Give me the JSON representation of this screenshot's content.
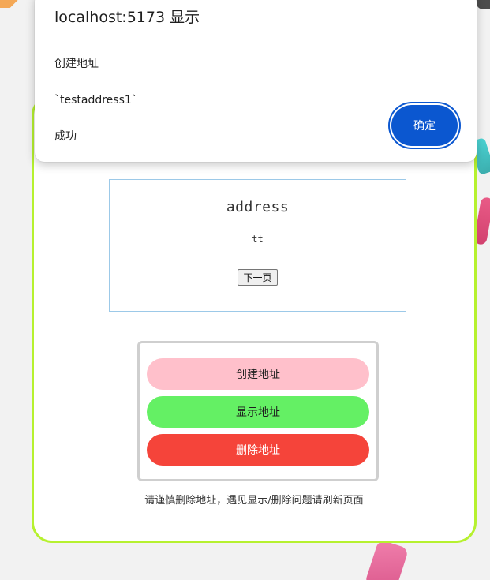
{
  "alert": {
    "title": "localhost:5173 显示",
    "message_lines": [
      "创建地址",
      "`testaddress1`",
      "成功"
    ],
    "ok_label": "确定"
  },
  "address_panel": {
    "title": "address",
    "value": "tt",
    "next_label": "下一页"
  },
  "actions": {
    "create_label": "创建地址",
    "show_label": "显示地址",
    "delete_label": "删除地址"
  },
  "notice": "请谨慎删除地址，遇见显示/删除问题请刷新页面",
  "colors": {
    "card_border": "#b6f12f",
    "create_btn": "#ffc0cb",
    "show_btn": "#64f064",
    "delete_btn": "#f5443a",
    "dialog_accent": "#0b57d0"
  }
}
